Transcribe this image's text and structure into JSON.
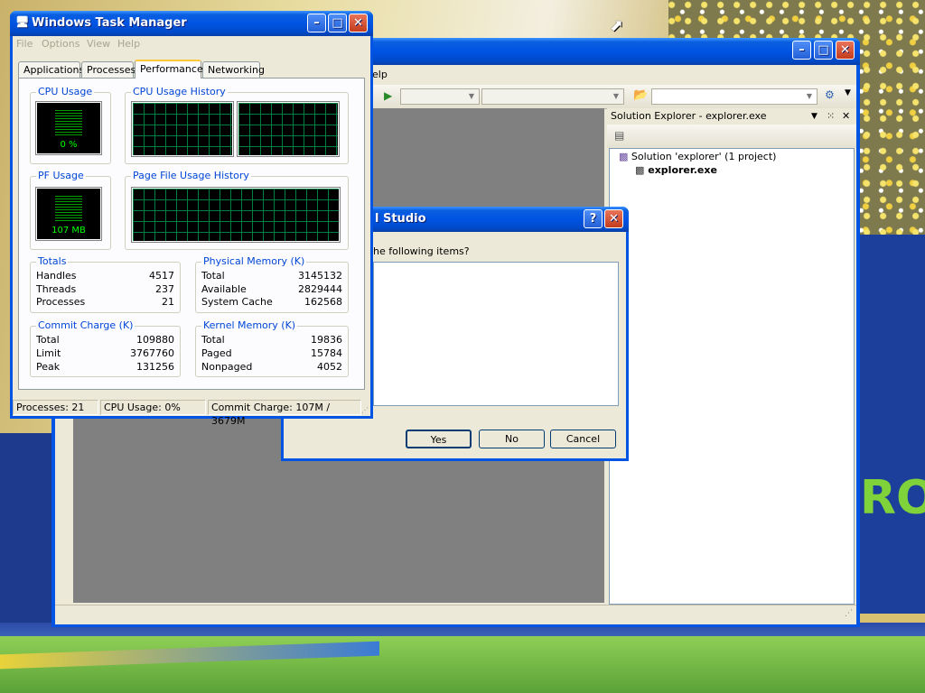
{
  "background": {
    "banner_text": "RO"
  },
  "visual_studio": {
    "title": "",
    "menu_fragment": "elp",
    "solution_explorer": {
      "header": "Solution Explorer - explorer.exe",
      "solution_label": "Solution 'explorer' (1 project)",
      "project_label": "explorer.exe"
    }
  },
  "dialog": {
    "title": "l Studio",
    "prompt": "he following items?",
    "yes_label": "Yes",
    "no_label": "No",
    "cancel_label": "Cancel"
  },
  "task_manager": {
    "title": "Windows Task Manager",
    "menu": [
      "File",
      "Options",
      "View",
      "Help"
    ],
    "tabs": [
      "Applications",
      "Processes",
      "Performance",
      "Networking"
    ],
    "active_tab": "Performance",
    "cpu_usage": {
      "label": "CPU Usage",
      "value": "0 %"
    },
    "cpu_history": {
      "label": "CPU Usage History"
    },
    "pf_usage": {
      "label": "PF Usage",
      "value": "107 MB"
    },
    "pf_history": {
      "label": "Page File Usage History"
    },
    "totals": {
      "label": "Totals",
      "rows": [
        {
          "k": "Handles",
          "v": "4517"
        },
        {
          "k": "Threads",
          "v": "237"
        },
        {
          "k": "Processes",
          "v": "21"
        }
      ]
    },
    "physical_memory": {
      "label": "Physical Memory (K)",
      "rows": [
        {
          "k": "Total",
          "v": "3145132"
        },
        {
          "k": "Available",
          "v": "2829444"
        },
        {
          "k": "System Cache",
          "v": "162568"
        }
      ]
    },
    "commit_charge": {
      "label": "Commit Charge (K)",
      "rows": [
        {
          "k": "Total",
          "v": "109880"
        },
        {
          "k": "Limit",
          "v": "3767760"
        },
        {
          "k": "Peak",
          "v": "131256"
        }
      ]
    },
    "kernel_memory": {
      "label": "Kernel Memory (K)",
      "rows": [
        {
          "k": "Total",
          "v": "19836"
        },
        {
          "k": "Paged",
          "v": "15784"
        },
        {
          "k": "Nonpaged",
          "v": "4052"
        }
      ]
    },
    "status": {
      "processes": "Processes: 21",
      "cpu": "CPU Usage: 0%",
      "commit": "Commit Charge: 107M / 3679M"
    }
  }
}
